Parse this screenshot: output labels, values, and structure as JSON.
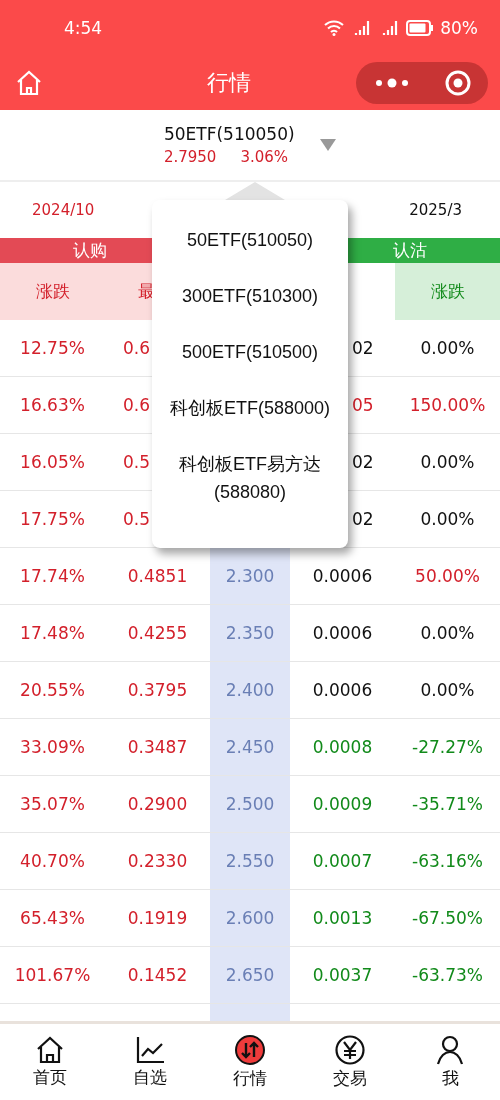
{
  "status_bar": {
    "time": "4:54",
    "battery": "80%"
  },
  "header": {
    "title": "行情"
  },
  "underlying": {
    "name": "50ETF(510050)",
    "price": "2.7950",
    "change": "3.06%"
  },
  "expiries": [
    {
      "label": "2024/10",
      "selected": true
    },
    {
      "label": "2025/3",
      "selected": false
    }
  ],
  "sides": [
    {
      "label": "认购",
      "kind": "call"
    },
    {
      "label": "认沽",
      "kind": "put"
    }
  ],
  "call_headers": [
    "涨跌",
    "最"
  ],
  "put_headers": [
    "涨跌"
  ],
  "rows": [
    {
      "kind": "covered",
      "call_change": "12.75%",
      "call_last": "0.6",
      "put_last": {
        "text": "02",
        "color": "#111111"
      },
      "put_change": {
        "text": "0.00%",
        "color": "#111111"
      }
    },
    {
      "kind": "covered",
      "call_change": "16.63%",
      "call_last": "0.6",
      "put_last": {
        "text": "05",
        "color": "#d3202b"
      },
      "put_change": {
        "text": "150.00%",
        "color": "#d3202b"
      }
    },
    {
      "kind": "covered",
      "call_change": "16.05%",
      "call_last": "0.5",
      "put_last": {
        "text": "02",
        "color": "#111111"
      },
      "put_change": {
        "text": "0.00%",
        "color": "#111111"
      }
    },
    {
      "kind": "covered",
      "call_change": "17.75%",
      "call_last": "0.5",
      "put_last": {
        "text": "02",
        "color": "#111111"
      },
      "put_change": {
        "text": "0.00%",
        "color": "#111111"
      }
    },
    {
      "kind": "full",
      "call_change": "17.74%",
      "call_last": "0.4851",
      "strike": "2.300",
      "put_last": {
        "text": "0.0006",
        "color": "#111111"
      },
      "put_change": {
        "text": "50.00%",
        "color": "#d3202b"
      }
    },
    {
      "kind": "full",
      "call_change": "17.48%",
      "call_last": "0.4255",
      "strike": "2.350",
      "put_last": {
        "text": "0.0006",
        "color": "#111111"
      },
      "put_change": {
        "text": "0.00%",
        "color": "#111111"
      }
    },
    {
      "kind": "full",
      "call_change": "20.55%",
      "call_last": "0.3795",
      "strike": "2.400",
      "put_last": {
        "text": "0.0006",
        "color": "#111111"
      },
      "put_change": {
        "text": "0.00%",
        "color": "#111111"
      }
    },
    {
      "kind": "full",
      "call_change": "33.09%",
      "call_last": "0.3487",
      "strike": "2.450",
      "put_last": {
        "text": "0.0008",
        "color": "#118a1a"
      },
      "put_change": {
        "text": "-27.27%",
        "color": "#118a1a"
      }
    },
    {
      "kind": "full",
      "call_change": "35.07%",
      "call_last": "0.2900",
      "strike": "2.500",
      "put_last": {
        "text": "0.0009",
        "color": "#118a1a"
      },
      "put_change": {
        "text": "-35.71%",
        "color": "#118a1a"
      }
    },
    {
      "kind": "full",
      "call_change": "40.70%",
      "call_last": "0.2330",
      "strike": "2.550",
      "put_last": {
        "text": "0.0007",
        "color": "#118a1a"
      },
      "put_change": {
        "text": "-63.16%",
        "color": "#118a1a"
      }
    },
    {
      "kind": "full",
      "call_change": "65.43%",
      "call_last": "0.1919",
      "strike": "2.600",
      "put_last": {
        "text": "0.0013",
        "color": "#118a1a"
      },
      "put_change": {
        "text": "-67.50%",
        "color": "#118a1a"
      }
    },
    {
      "kind": "full",
      "call_change": "101.67%",
      "call_last": "0.1452",
      "strike": "2.650",
      "put_last": {
        "text": "0.0037",
        "color": "#118a1a"
      },
      "put_change": {
        "text": "-63.73%",
        "color": "#118a1a"
      }
    }
  ],
  "dropdown": [
    "50ETF(510050)",
    "300ETF(510300)",
    "500ETF(510500)",
    "科创板ETF(588000)",
    "科创板ETF易方达(588080)"
  ],
  "tabbar": [
    {
      "label": "首页",
      "kind": "home",
      "selected": false
    },
    {
      "label": "自选",
      "kind": "chart",
      "selected": false
    },
    {
      "label": "行情",
      "kind": "market",
      "selected": true
    },
    {
      "label": "交易",
      "kind": "trade",
      "selected": false
    },
    {
      "label": "我",
      "kind": "me",
      "selected": false
    }
  ]
}
